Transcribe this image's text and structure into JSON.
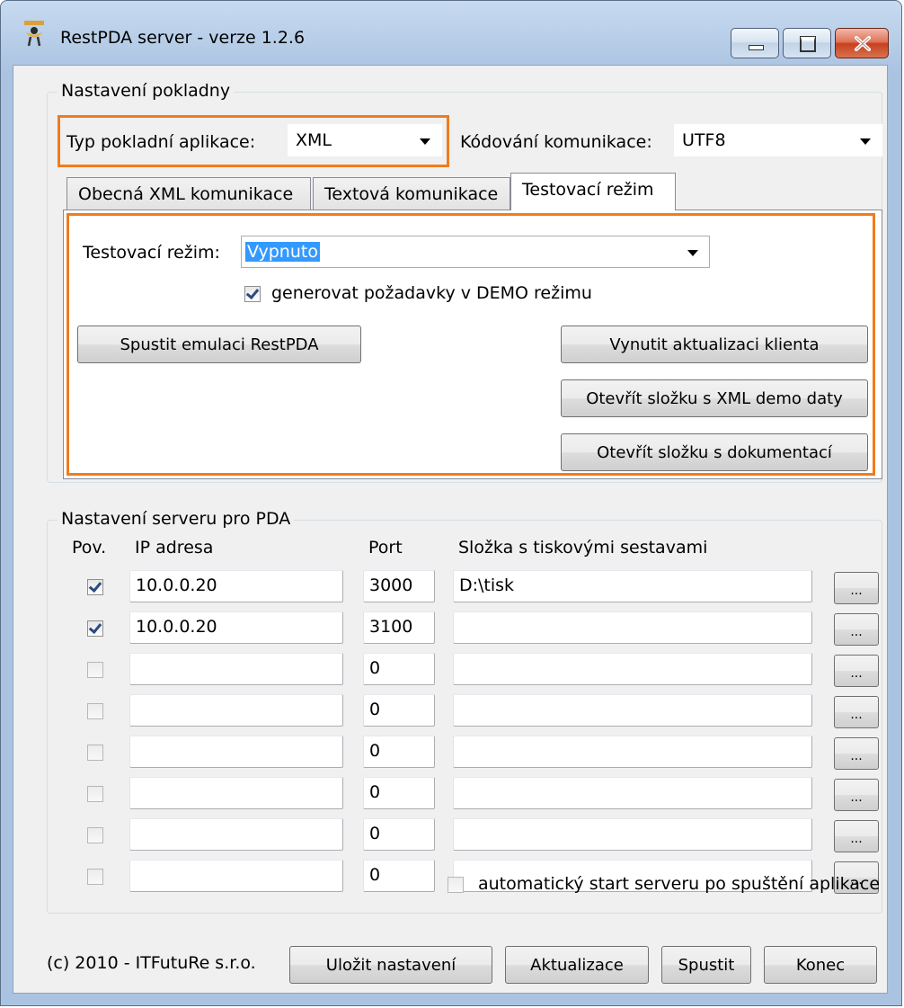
{
  "window": {
    "title": "RestPDA server - verze 1.2.6",
    "icon": "restpda-app-icon",
    "controls": [
      "minimize-icon",
      "maximize-icon",
      "close-icon"
    ]
  },
  "cash_register": {
    "group_title": "Nastavení pokladny",
    "app_type_label": "Typ pokladní aplikace:",
    "app_type_value": "XML",
    "encoding_label": "Kódování komunikace:",
    "encoding_value": "UTF8"
  },
  "tabs": [
    {
      "label": "Obecná XML komunikace",
      "active": false
    },
    {
      "label": "Textová komunikace",
      "active": false
    },
    {
      "label": "Testovací režim",
      "active": true
    }
  ],
  "test_mode": {
    "label": "Testovací režim:",
    "value": "Vypnuto",
    "demo_checkbox_label": "generovat požadavky v DEMO režimu",
    "demo_checked": true,
    "emulate_button": "Spustit emulaci RestPDA",
    "force_update_button": "Vynutit aktualizaci klienta",
    "open_xml_demo_button": "Otevřít složku s XML demo daty",
    "open_docs_button": "Otevřít složku s dokumentací"
  },
  "server": {
    "group_title": "Nastavení serveru pro PDA",
    "columns": {
      "enabled": "Pov.",
      "ip": "IP adresa",
      "port": "Port",
      "folder": "Složka s tiskovými sestavami"
    },
    "browse_label": "...",
    "rows": [
      {
        "enabled": true,
        "ip": "10.0.0.20",
        "port": "3000",
        "folder": "D:\\tisk"
      },
      {
        "enabled": true,
        "ip": "10.0.0.20",
        "port": "3100",
        "folder": ""
      },
      {
        "enabled": false,
        "ip": "",
        "port": "0",
        "folder": ""
      },
      {
        "enabled": false,
        "ip": "",
        "port": "0",
        "folder": ""
      },
      {
        "enabled": false,
        "ip": "",
        "port": "0",
        "folder": ""
      },
      {
        "enabled": false,
        "ip": "",
        "port": "0",
        "folder": ""
      },
      {
        "enabled": false,
        "ip": "",
        "port": "0",
        "folder": ""
      },
      {
        "enabled": false,
        "ip": "",
        "port": "0",
        "folder": ""
      }
    ],
    "autostart_label": "automatický start serveru po spuštění aplikace",
    "autostart_checked": false
  },
  "footer": {
    "copyright": "(c) 2010 - ITFutuRe s.r.o.",
    "save_button": "Uložit nastavení",
    "update_button": "Aktualizace",
    "start_button": "Spustit",
    "exit_button": "Konec"
  },
  "colors": {
    "highlight": "#f07c1c",
    "selection": "#3399ff",
    "window_frame": "#b9cfe9",
    "client_background": "#f0f0f0"
  }
}
